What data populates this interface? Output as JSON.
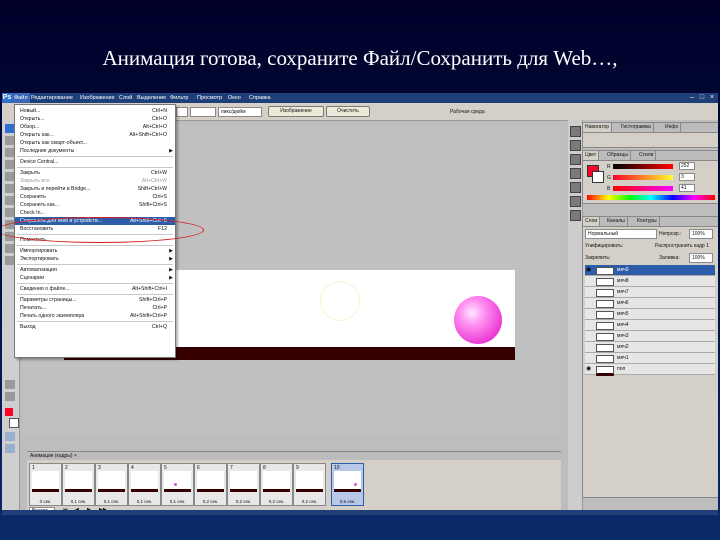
{
  "slide": {
    "title": "Анимация готова, сохраните Файл/Сохранить для Web…,"
  },
  "app": {
    "logo": "Ps",
    "menu": [
      "Файл",
      "Редактирование",
      "Изображение",
      "Слой",
      "Выделение",
      "Фильтр",
      "Просмотр",
      "Окно",
      "Справка"
    ],
    "window_controls": [
      "–",
      "□",
      "×"
    ]
  },
  "options_bar": {
    "resolution_unit": "пикс/дюйм",
    "image_button": "Изображение",
    "clear_button": "Очистить",
    "workspace": "Рабочая среда"
  },
  "file_menu": {
    "items": [
      {
        "label": "Новый...",
        "shortcut": "Ctrl+N"
      },
      {
        "label": "Открыть...",
        "shortcut": "Ctrl+O"
      },
      {
        "label": "Обзор...",
        "shortcut": "Alt+Ctrl+O"
      },
      {
        "label": "Открыть как...",
        "shortcut": "Alt+Shift+Ctrl+O"
      },
      {
        "label": "Открыть как смарт-объект...",
        "shortcut": ""
      },
      {
        "label": "Последние документы",
        "shortcut": "",
        "submenu": true
      },
      {
        "label": "Device Central...",
        "shortcut": ""
      },
      {
        "label": "Закрыть",
        "shortcut": "Ctrl+W"
      },
      {
        "label": "Закрыть все",
        "shortcut": "Alt+Ctrl+W",
        "disabled": true
      },
      {
        "label": "Закрыть и перейти в Bridge...",
        "shortcut": "Shift+Ctrl+W"
      },
      {
        "label": "Сохранить",
        "shortcut": "Ctrl+S"
      },
      {
        "label": "Сохранить как...",
        "shortcut": "Shift+Ctrl+S"
      },
      {
        "label": "Check In...",
        "shortcut": ""
      },
      {
        "label": "Сохранить для Web и устройств...",
        "shortcut": "Alt+Shift+Ctrl+S",
        "highlighted": true
      },
      {
        "label": "Восстановить",
        "shortcut": "F12"
      },
      {
        "label": "Поместить...",
        "shortcut": ""
      },
      {
        "label": "Импортировать",
        "shortcut": "",
        "submenu": true
      },
      {
        "label": "Экспортировать",
        "shortcut": "",
        "submenu": true
      },
      {
        "label": "Автоматизация",
        "shortcut": "",
        "submenu": true
      },
      {
        "label": "Сценарии",
        "shortcut": "",
        "submenu": true
      },
      {
        "label": "Сведения о файле...",
        "shortcut": "Alt+Shift+Ctrl+I"
      },
      {
        "label": "Параметры страницы...",
        "shortcut": "Shift+Ctrl+P"
      },
      {
        "label": "Печатать...",
        "shortcut": "Ctrl+P"
      },
      {
        "label": "Печать одного экземпляра",
        "shortcut": "Alt+Shift+Ctrl+P"
      },
      {
        "label": "Выход",
        "shortcut": "Ctrl+Q"
      }
    ]
  },
  "right_panels": {
    "nav_tabs": [
      "Навигатор",
      "Гистограмма",
      "Инфо"
    ],
    "color_tabs": [
      "Цвет",
      "Образцы",
      "Стили"
    ],
    "color_values": {
      "R": "252",
      "G": "3",
      "B": "41"
    },
    "layers_tabs": [
      "Слои",
      "Каналы",
      "Контуры"
    ],
    "blend_mode": "Нормальный",
    "opacity_label": "Непрозр.:",
    "opacity_value": "100%",
    "unify_label": "Унифицировать:",
    "propagate_label": "Распространить кадр 1",
    "lock_label": "Закрепить:",
    "fill_label": "Заливка:",
    "fill_value": "100%",
    "layers": [
      "мяч9",
      "мяч8",
      "мяч7",
      "мяч6",
      "мяч5",
      "мяч4",
      "мяч3",
      "мяч2",
      "мяч1",
      "пол"
    ]
  },
  "animation": {
    "title": "Анимация (кадры) ×",
    "loop": "Всегда",
    "frames": [
      {
        "n": "1",
        "delay": "0 сек."
      },
      {
        "n": "2",
        "delay": "0,1 сек."
      },
      {
        "n": "3",
        "delay": "0,1 сек."
      },
      {
        "n": "4",
        "delay": "0,1 сек."
      },
      {
        "n": "5",
        "delay": "0,1 сек."
      },
      {
        "n": "6",
        "delay": "0,2 сек."
      },
      {
        "n": "7",
        "delay": "0,2 сек."
      },
      {
        "n": "8",
        "delay": "0,2 сек."
      },
      {
        "n": "9",
        "delay": "0,2 сек."
      },
      {
        "n": "10",
        "delay": "0,5 сек."
      }
    ]
  },
  "colors": {
    "accent_menu": "#2d5ca8",
    "highlight_oval": "#d81c1c",
    "foreground_swatch": "#fc0329"
  }
}
